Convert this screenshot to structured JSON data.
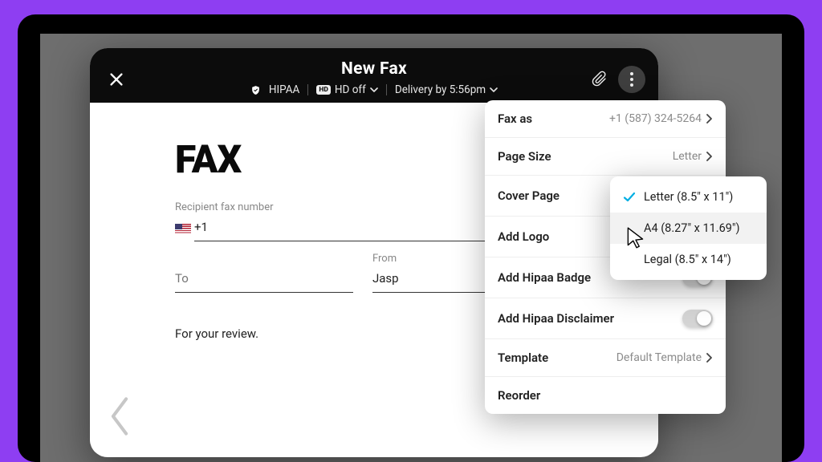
{
  "header": {
    "title": "New Fax",
    "hipaa_label": "HIPAA",
    "hd_label": "HD off",
    "delivery_label": "Delivery by 5:56pm"
  },
  "document": {
    "logo_text": "FAX",
    "recipient_label": "Recipient fax number",
    "recipient_prefix": "+1",
    "to_label": "To",
    "from_label": "From",
    "from_value": "Jasp",
    "body": "For your review."
  },
  "options": {
    "fax_as": {
      "label": "Fax as",
      "value": "+1 (587) 324-5264"
    },
    "page_size": {
      "label": "Page Size",
      "value": "Letter"
    },
    "cover_page": {
      "label": "Cover Page",
      "on": true
    },
    "add_logo": {
      "label": "Add Logo",
      "on": true
    },
    "add_hipaa_badge": {
      "label": "Add Hipaa Badge",
      "on": false
    },
    "add_hipaa_disclaimer": {
      "label": "Add Hipaa Disclaimer",
      "on": false
    },
    "template": {
      "label": "Template",
      "value": "Default Template"
    },
    "reorder": {
      "label": "Reorder"
    }
  },
  "page_size_menu": {
    "items": [
      {
        "label": "Letter (8.5\" x 11\")",
        "selected": true,
        "hover": false
      },
      {
        "label": "A4 (8.27\" x 11.69\")",
        "selected": false,
        "hover": true
      },
      {
        "label": "Legal (8.5\" x 14\")",
        "selected": false,
        "hover": false
      }
    ]
  }
}
